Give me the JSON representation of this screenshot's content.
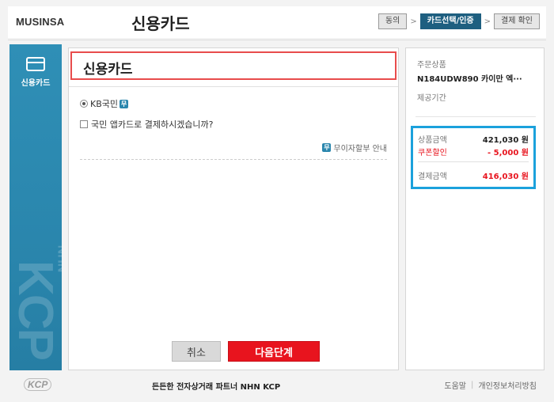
{
  "header": {
    "brand": "MUSINSA",
    "title": "신용카드",
    "steps": [
      "동의",
      "카드선택/인증",
      "결제 확인"
    ],
    "step_arrow": ">"
  },
  "sidebar": {
    "label": "신용카드",
    "watermark": "KCP",
    "watermark_small": "NHN"
  },
  "main": {
    "section_title": "신용카드",
    "selected_card": "KB국민",
    "info_badge": "무",
    "app_card_question": "국민 앱카드로 결제하시겠습니까?",
    "installment_label": "무이자할부 안내",
    "cancel_label": "취소",
    "next_label": "다음단계"
  },
  "order": {
    "product_label": "주문상품",
    "product_name": "N184UDW890 카이만 엑···",
    "period_label": "제공기간",
    "subtotal_label": "상품금액",
    "subtotal_value": "421,030 원",
    "coupon_label": "쿠폰할인",
    "coupon_value": "- 5,000 원",
    "total_label": "결제금액",
    "total_value": "416,030 원"
  },
  "footer": {
    "logo": "KCP",
    "tagline": "든든한 전자상거래 파트너 NHN KCP",
    "help_link": "도움말",
    "separator": "|",
    "privacy_link": "개인정보처리방침"
  },
  "colors": {
    "sidebar": "#2a86ad",
    "highlight_red": "#e84c4c",
    "button_red": "#e8141e",
    "summary_border": "#1ba1dc",
    "active_step": "#1e5f80"
  }
}
